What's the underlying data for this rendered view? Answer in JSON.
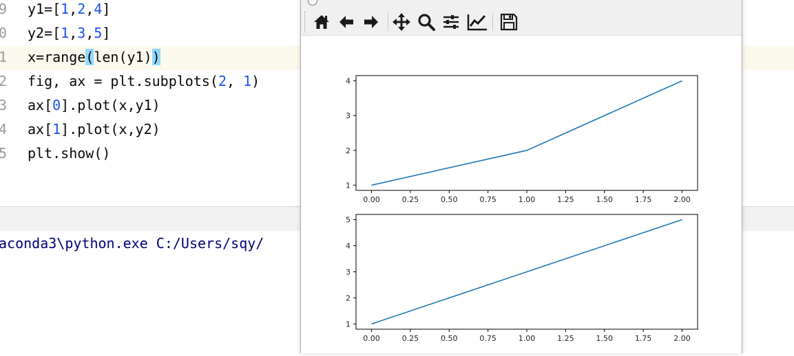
{
  "editor": {
    "lines": [
      {
        "num": "9",
        "code": "y1=[1,2,4]"
      },
      {
        "num": "0",
        "code": "y2=[1,3,5]"
      },
      {
        "num": "1",
        "code": "x=range(len(y1))"
      },
      {
        "num": "2",
        "code": "fig, ax = plt.subplots(2, 1)"
      },
      {
        "num": "3",
        "code": "ax[0].plot(x,y1)"
      },
      {
        "num": "4",
        "code": "ax[1].plot(x,y2)"
      },
      {
        "num": "5",
        "code": "plt.show()"
      }
    ]
  },
  "console": {
    "output": "aconda3\\python.exe C:/Users/sqy/"
  },
  "figure_window": {
    "toolbar": {
      "buttons": [
        {
          "name": "home-icon",
          "tip": "Home"
        },
        {
          "name": "back-icon",
          "tip": "Back"
        },
        {
          "name": "forward-icon",
          "tip": "Forward"
        },
        {
          "name": "pan-icon",
          "tip": "Pan"
        },
        {
          "name": "zoom-icon",
          "tip": "Zoom"
        },
        {
          "name": "subplots-icon",
          "tip": "Subplots"
        },
        {
          "name": "axes-edit-icon",
          "tip": "Customize"
        },
        {
          "name": "save-icon",
          "tip": "Save"
        }
      ]
    }
  },
  "chart_data": [
    {
      "type": "line",
      "x": [
        0,
        1,
        2
      ],
      "series": [
        {
          "values": [
            1,
            2,
            4
          ],
          "color": "#1f77b4"
        }
      ],
      "xlim": [
        -0.1,
        2.1
      ],
      "ylim": [
        0.85,
        4.15
      ],
      "xticks": [
        "0.00",
        "0.25",
        "0.50",
        "0.75",
        "1.00",
        "1.25",
        "1.50",
        "1.75",
        "2.00"
      ],
      "yticks": [
        "1",
        "2",
        "3",
        "4"
      ]
    },
    {
      "type": "line",
      "x": [
        0,
        1,
        2
      ],
      "series": [
        {
          "values": [
            1,
            3,
            5
          ],
          "color": "#1f77b4"
        }
      ],
      "xlim": [
        -0.1,
        2.1
      ],
      "ylim": [
        0.8,
        5.2
      ],
      "xticks": [
        "0.00",
        "0.25",
        "0.50",
        "0.75",
        "1.00",
        "1.25",
        "1.50",
        "1.75",
        "2.00"
      ],
      "yticks": [
        "1",
        "2",
        "3",
        "4",
        "5"
      ]
    }
  ]
}
